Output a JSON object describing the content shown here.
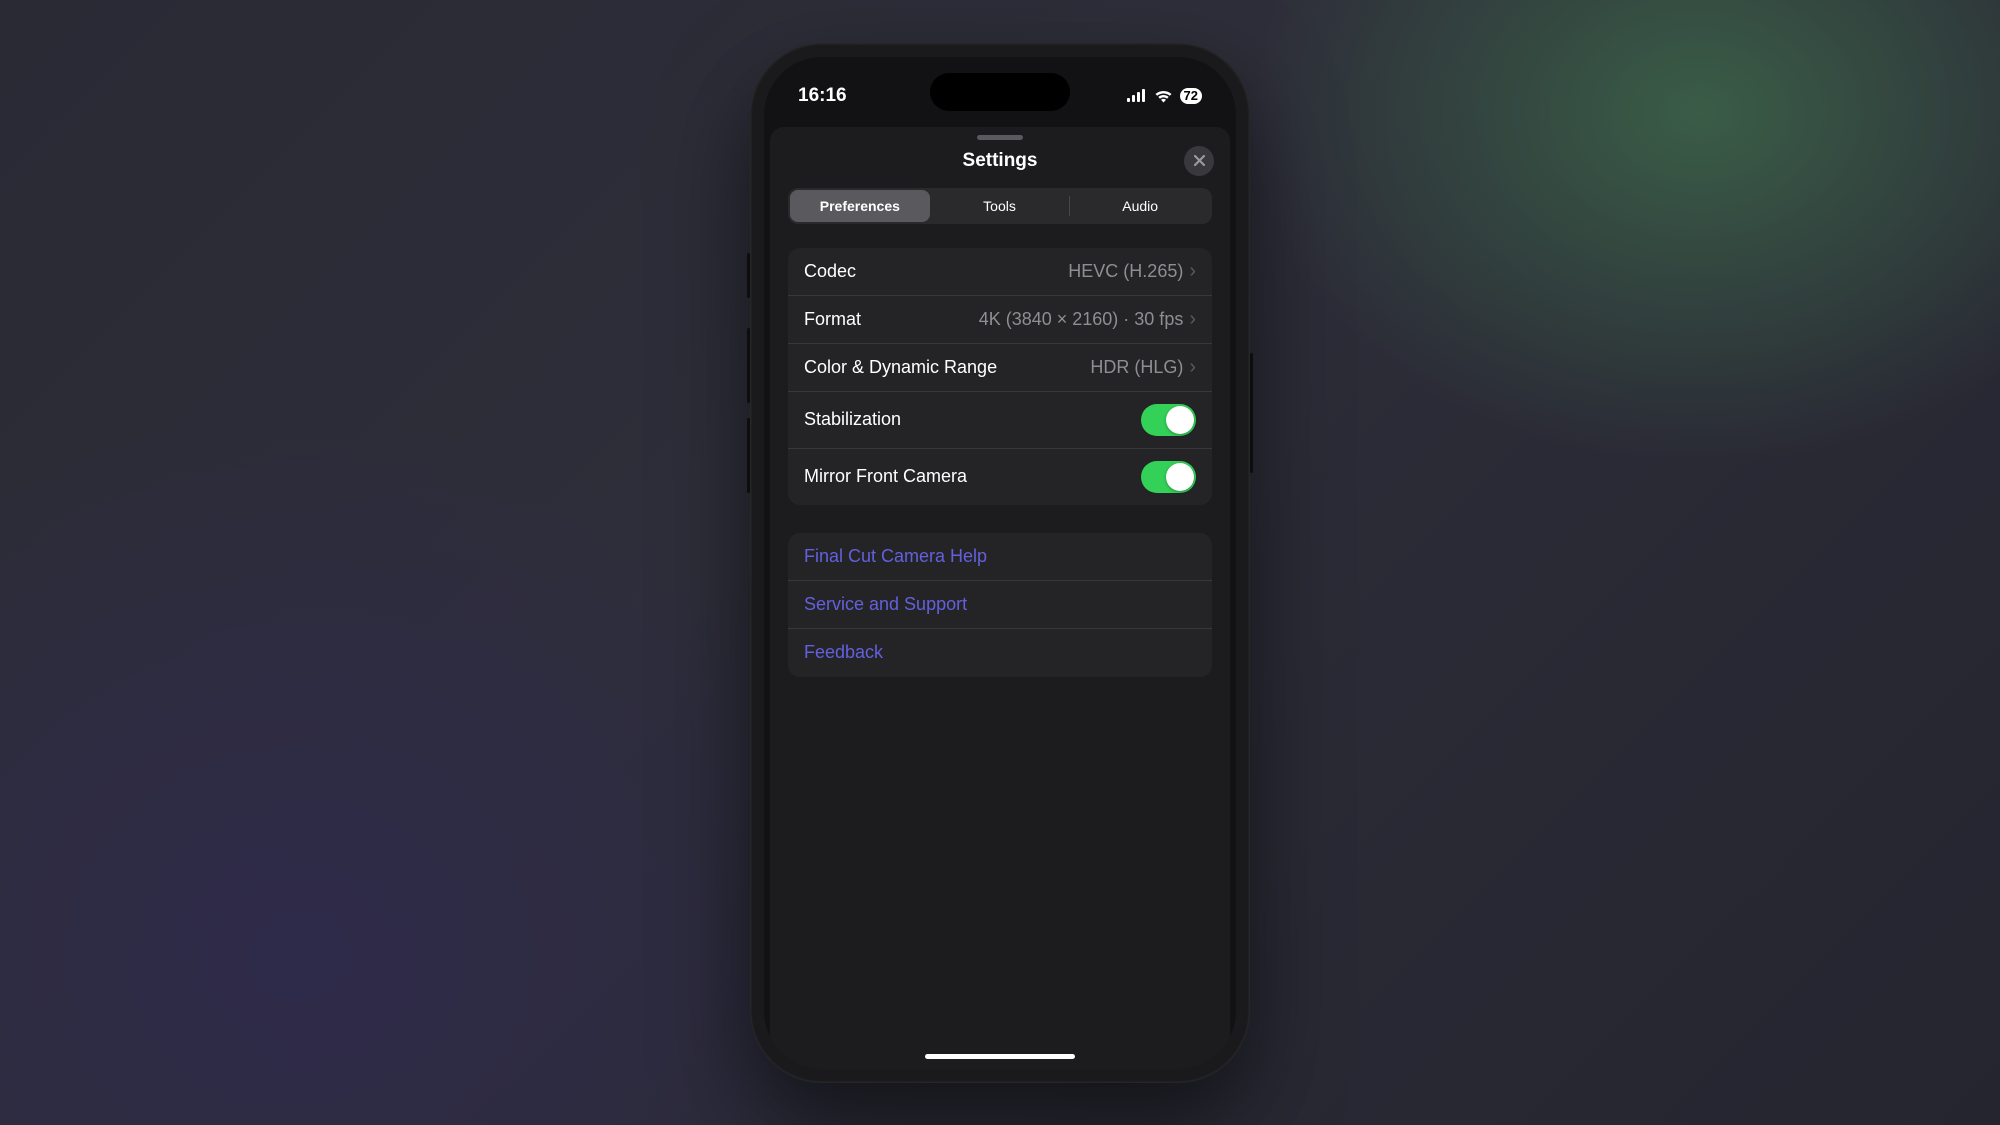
{
  "status": {
    "time": "16:16",
    "battery": "72"
  },
  "sheet": {
    "title": "Settings",
    "tabs": {
      "preferences": "Preferences",
      "tools": "Tools",
      "audio": "Audio"
    }
  },
  "prefs": {
    "codec": {
      "label": "Codec",
      "value": "HEVC (H.265)"
    },
    "format": {
      "label": "Format",
      "value": "4K (3840 × 2160) · 30 fps"
    },
    "color": {
      "label": "Color & Dynamic Range",
      "value": "HDR (HLG)"
    },
    "stabilization": {
      "label": "Stabilization"
    },
    "mirror": {
      "label": "Mirror Front Camera"
    }
  },
  "links": {
    "help": "Final Cut Camera Help",
    "support": "Service and Support",
    "feedback": "Feedback"
  }
}
